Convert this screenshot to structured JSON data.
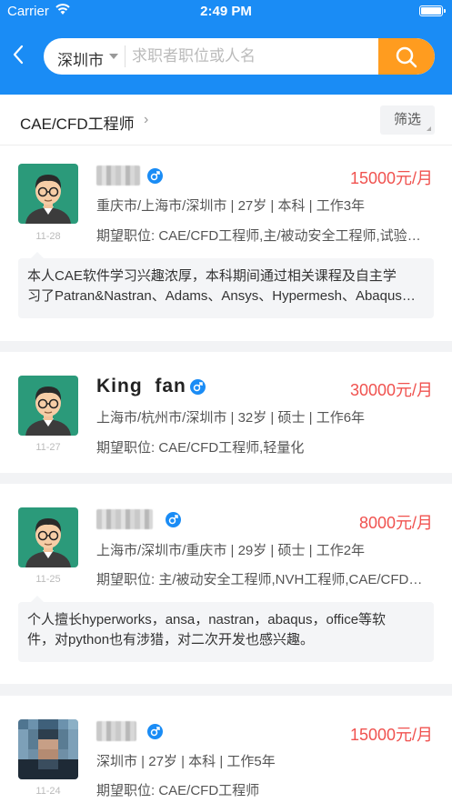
{
  "status_bar": {
    "carrier": "Carrier",
    "time": "2:49 PM"
  },
  "search": {
    "city": "深圳市",
    "placeholder": "求职者职位或人名",
    "value": ""
  },
  "filter_bar": {
    "title": "CAE/CFD工程师",
    "filter_label": "筛选"
  },
  "colors": {
    "primary": "#1a8cf5",
    "accent": "#ff9c1f",
    "salary": "#f0524f"
  },
  "candidates": [
    {
      "name": "",
      "name_blurred": true,
      "gender_icon": "male-icon",
      "salary": "15000元/月",
      "info": "重庆市/上海市/深圳市 | 27岁 | 本科 | 工作3年",
      "expect": "期望职位: CAE/CFD工程师,主/被动安全工程师,试验工程师",
      "date": "11-28",
      "intro_line1": "本人CAE软件学习兴趣浓厚，本科期间通过相关课程及自主学",
      "intro_line2": "习了Patran&Nastran、Adams、Ansys、Hypermesh、Abaqus等软件"
    },
    {
      "name": "King  fan",
      "name_blurred": false,
      "gender_icon": "male-icon",
      "salary": "30000元/月",
      "info": "上海市/杭州市/深圳市 | 32岁 | 硕士 | 工作6年",
      "expect": "期望职位: CAE/CFD工程师,轻量化",
      "date": "11-27"
    },
    {
      "name": "",
      "name_blurred": true,
      "gender_icon": "male-icon",
      "salary": "8000元/月",
      "info": "上海市/深圳市/重庆市 | 29岁 | 硕士 | 工作2年",
      "expect": "期望职位: 主/被动安全工程师,NVH工程师,CAE/CFD工程师",
      "date": "11-25",
      "intro_line1": "个人擅长hyperworks，ansa，nastran，abaqus，office等软",
      "intro_line2": "件，对python也有涉猎，对二次开发也感兴趣。"
    },
    {
      "name": "",
      "name_blurred": true,
      "gender_icon": "male-icon",
      "salary": "15000元/月",
      "info": "深圳市 | 27岁 | 本科 | 工作5年",
      "expect": "期望职位: CAE/CFD工程师",
      "date": "11-24"
    }
  ]
}
